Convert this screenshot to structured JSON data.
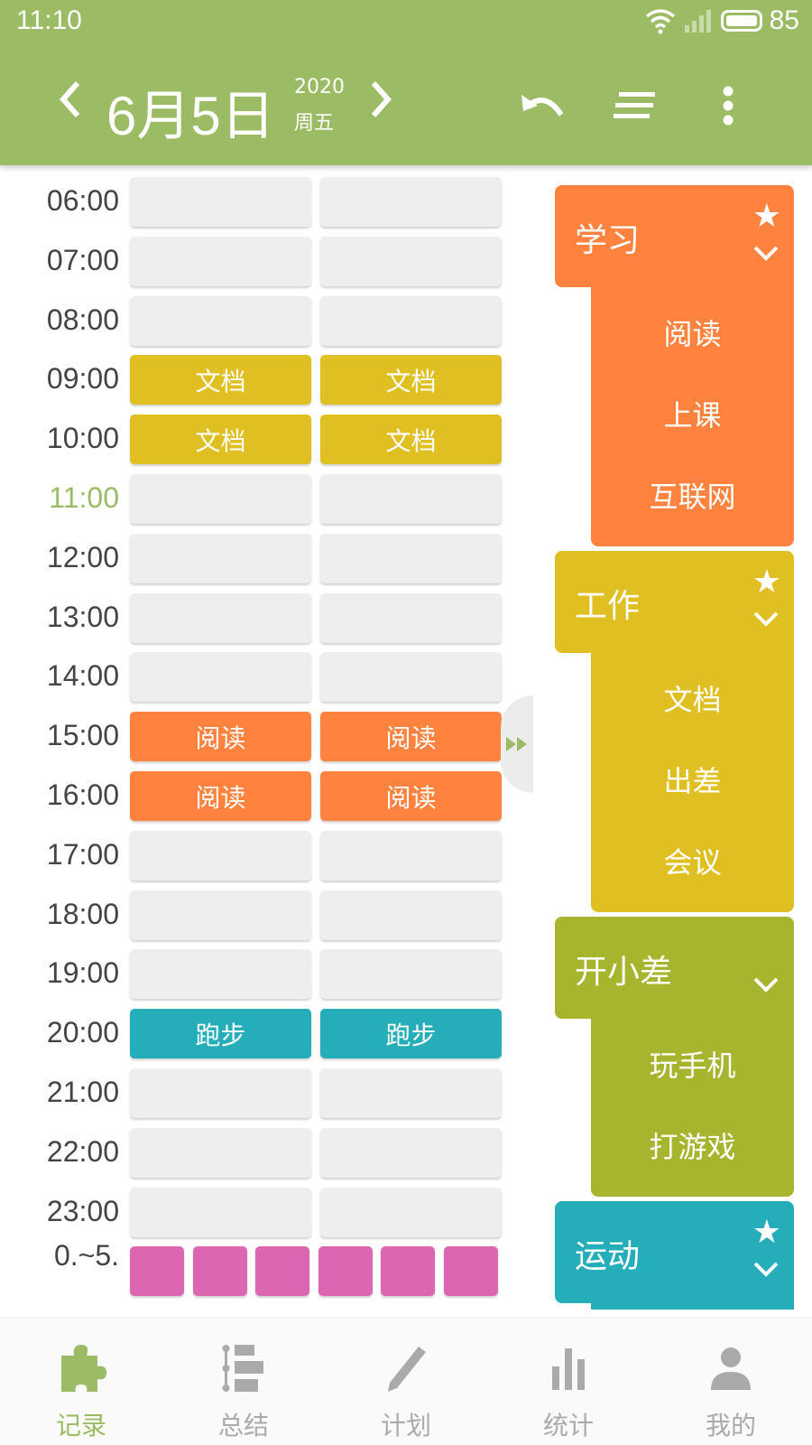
{
  "status_bar": {
    "time": "11:10",
    "battery": "85"
  },
  "header": {
    "date": "6月5日",
    "year": "2020",
    "weekday": "周五"
  },
  "colors": {
    "primary": "#9bbb64",
    "study": "#ff833e",
    "work": "#dfbf22",
    "slack": "#a6b42e",
    "sport": "#25adb9",
    "night": "#dd66b2",
    "empty": "#eeeeee"
  },
  "timeline": {
    "rows": [
      {
        "time": "06:00",
        "cells": [
          "",
          ""
        ],
        "type": [
          "empty",
          "empty"
        ]
      },
      {
        "time": "07:00",
        "cells": [
          "",
          ""
        ],
        "type": [
          "empty",
          "empty"
        ]
      },
      {
        "time": "08:00",
        "cells": [
          "",
          ""
        ],
        "type": [
          "empty",
          "empty"
        ]
      },
      {
        "time": "09:00",
        "cells": [
          "文档",
          "文档"
        ],
        "type": [
          "work",
          "work"
        ]
      },
      {
        "time": "10:00",
        "cells": [
          "文档",
          "文档"
        ],
        "type": [
          "work",
          "work"
        ]
      },
      {
        "time": "11:00",
        "cells": [
          "",
          ""
        ],
        "type": [
          "empty",
          "empty"
        ],
        "current": true
      },
      {
        "time": "12:00",
        "cells": [
          "",
          ""
        ],
        "type": [
          "empty",
          "empty"
        ]
      },
      {
        "time": "13:00",
        "cells": [
          "",
          ""
        ],
        "type": [
          "empty",
          "empty"
        ]
      },
      {
        "time": "14:00",
        "cells": [
          "",
          ""
        ],
        "type": [
          "empty",
          "empty"
        ]
      },
      {
        "time": "15:00",
        "cells": [
          "阅读",
          "阅读"
        ],
        "type": [
          "study",
          "study"
        ]
      },
      {
        "time": "16:00",
        "cells": [
          "阅读",
          "阅读"
        ],
        "type": [
          "study",
          "study"
        ]
      },
      {
        "time": "17:00",
        "cells": [
          "",
          ""
        ],
        "type": [
          "empty",
          "empty"
        ]
      },
      {
        "time": "18:00",
        "cells": [
          "",
          ""
        ],
        "type": [
          "empty",
          "empty"
        ]
      },
      {
        "time": "19:00",
        "cells": [
          "",
          ""
        ],
        "type": [
          "empty",
          "empty"
        ]
      },
      {
        "time": "20:00",
        "cells": [
          "跑步",
          "跑步"
        ],
        "type": [
          "sport",
          "sport"
        ]
      },
      {
        "time": "21:00",
        "cells": [
          "",
          ""
        ],
        "type": [
          "empty",
          "empty"
        ]
      },
      {
        "time": "22:00",
        "cells": [
          "",
          ""
        ],
        "type": [
          "empty",
          "empty"
        ]
      },
      {
        "time": "23:00",
        "cells": [
          "",
          ""
        ],
        "type": [
          "empty",
          "empty"
        ]
      }
    ],
    "night_label": "0.~5.",
    "night_blocks": 6
  },
  "categories": [
    {
      "name": "学习",
      "key": "study",
      "starred": true,
      "items": [
        "阅读",
        "上课",
        "互联网"
      ]
    },
    {
      "name": "工作",
      "key": "work",
      "starred": true,
      "items": [
        "文档",
        "出差",
        "会议"
      ]
    },
    {
      "name": "开小差",
      "key": "slack",
      "starred": false,
      "items": [
        "玩手机",
        "打游戏"
      ]
    },
    {
      "name": "运动",
      "key": "sport",
      "starred": true,
      "items": []
    }
  ],
  "bottom_nav": [
    {
      "label": "记录",
      "icon": "puzzle-icon",
      "active": true
    },
    {
      "label": "总结",
      "icon": "summary-list-icon",
      "active": false
    },
    {
      "label": "计划",
      "icon": "pencil-icon",
      "active": false
    },
    {
      "label": "统计",
      "icon": "bar-chart-icon",
      "active": false
    },
    {
      "label": "我的",
      "icon": "person-icon",
      "active": false
    }
  ]
}
